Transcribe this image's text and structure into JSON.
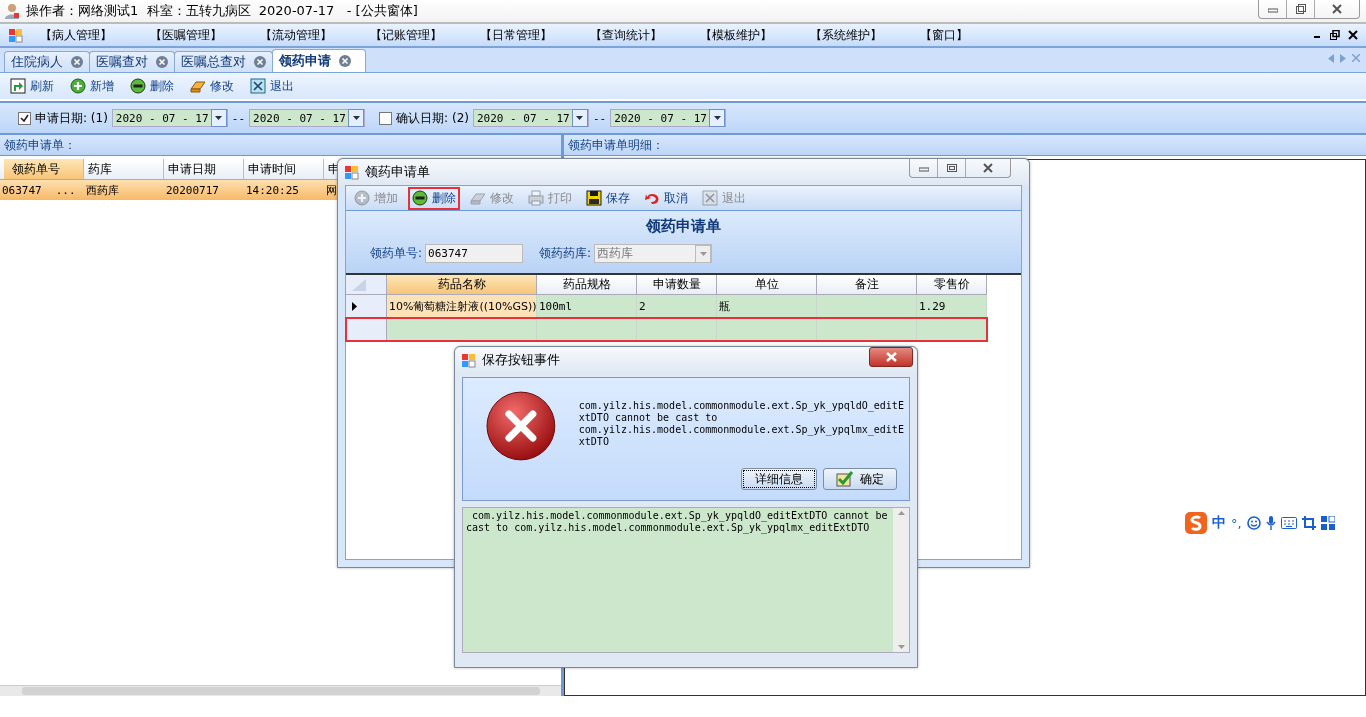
{
  "window": {
    "title": "操作者：网络测试1  科室：五转九病区  2020-07-17   - [公共窗体]"
  },
  "menu": [
    "【病人管理】",
    "【医嘱管理】",
    "【流动管理】",
    "【记账管理】",
    "【日常管理】",
    "【查询统计】",
    "【模板维护】",
    "【系统维护】",
    "【窗口】"
  ],
  "tabs": [
    {
      "label": "住院病人",
      "selected": false
    },
    {
      "label": "医嘱查对",
      "selected": false
    },
    {
      "label": "医嘱总查对",
      "selected": false
    },
    {
      "label": "领药申请",
      "selected": true
    }
  ],
  "toolbar": [
    {
      "kind": "refresh",
      "label": "刷新"
    },
    {
      "kind": "add",
      "label": "新增"
    },
    {
      "kind": "delete",
      "label": "删除"
    },
    {
      "kind": "edit",
      "label": "修改"
    },
    {
      "kind": "exit",
      "label": "退出"
    }
  ],
  "filters": [
    {
      "checked": true,
      "label": "申请日期:",
      "index": "(1)",
      "from": "2020 - 07 - 17",
      "separator": "--",
      "to": "2020 - 07 - 17"
    },
    {
      "checked": false,
      "label": "确认日期:",
      "index": "(2)",
      "from": "2020 - 07 - 17",
      "separator": "--",
      "to": "2020 - 07 - 17"
    }
  ],
  "left_panel": {
    "title": "领药申请单：",
    "columns": [
      "领药单号",
      "药库",
      "申请日期",
      "申请时间",
      "申"
    ],
    "rows": [
      {
        "selected": true,
        "cells": [
          "063747",
          "西药库",
          "20200717",
          "14:20:25",
          "网"
        ],
        "more": "..."
      }
    ]
  },
  "right_panel": {
    "title": "领药申请单明细："
  },
  "dialog": {
    "title": "领药申请单",
    "toolbar": [
      {
        "kind": "add",
        "label": "增加",
        "disabled": true,
        "highlighted": false
      },
      {
        "kind": "delete",
        "label": "删除",
        "disabled": false,
        "highlighted": true
      },
      {
        "kind": "edit",
        "label": "修改",
        "disabled": true,
        "highlighted": false
      },
      {
        "kind": "print",
        "label": "打印",
        "disabled": true,
        "highlighted": false
      },
      {
        "kind": "save",
        "label": "保存",
        "disabled": false,
        "highlighted": false
      },
      {
        "kind": "cancel",
        "label": "取消",
        "disabled": false,
        "highlighted": false
      },
      {
        "kind": "exit",
        "label": "退出",
        "disabled": true,
        "highlighted": false
      }
    ],
    "heading": "领药申请单",
    "fields": [
      {
        "label": "领药单号:",
        "value": "063747",
        "disabled": false
      },
      {
        "label": "领药药库:",
        "value": "西药库",
        "disabled": true
      }
    ],
    "columns": [
      "药品名称",
      "药品规格",
      "申请数量",
      "单位",
      "备注",
      "零售价"
    ],
    "rows": [
      {
        "current": true,
        "highlighted": false,
        "cells": [
          "10%葡萄糖注射液((10%GS))",
          "100ml",
          "2",
          "瓶",
          "",
          "1.29"
        ]
      },
      {
        "current": false,
        "highlighted": true,
        "cells": [
          "",
          "",
          "",
          "",
          "",
          ""
        ]
      }
    ]
  },
  "error_dialog": {
    "title": "保存按钮事件",
    "message": "com.yilz.his.model.commonmodule.ext.Sp_yk_ypqldO_editExtDTO cannot be cast to com.yilz.his.model.commonmodule.ext.Sp_yk_ypqlmx_editExtDTO",
    "buttons": [
      {
        "kind": "details",
        "label": "详细信息",
        "focused": true
      },
      {
        "kind": "ok",
        "label": "确定",
        "focused": false
      }
    ],
    "details": " com.yilz.his.model.commonmodule.ext.Sp_yk_ypqldO_editExtDTO cannot be cast to com.yilz.his.model.commonmodule.ext.Sp_yk_ypqlmx_editExtDTO"
  },
  "ime_bar": {
    "label": "中",
    "punctuation": "°,"
  }
}
